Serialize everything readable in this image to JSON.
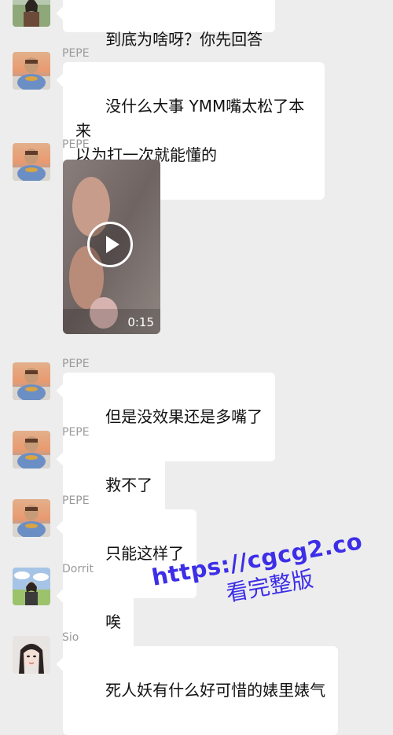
{
  "messages": [
    {
      "sender": "",
      "text": "到底为啥呀？你先回答",
      "avatar_icon": "landscape-girl-avatar-icon"
    },
    {
      "sender": "PEPE",
      "text": "没什么大事 YMM嘴太松了本来\n以为打一次就能懂的",
      "avatar_icon": "pepe-avatar-icon"
    },
    {
      "sender": "PEPE",
      "video": {
        "duration": "0:15"
      },
      "avatar_icon": "pepe-avatar-icon"
    },
    {
      "sender": "PEPE",
      "text": "但是没效果还是多嘴了",
      "avatar_icon": "pepe-avatar-icon"
    },
    {
      "sender": "PEPE",
      "text": "救不了",
      "avatar_icon": "pepe-avatar-icon"
    },
    {
      "sender": "PEPE",
      "text": "只能这样了",
      "avatar_icon": "pepe-avatar-icon"
    },
    {
      "sender": "Dorrit",
      "text": "唉",
      "avatar_icon": "dorrit-avatar-icon"
    },
    {
      "sender": "Sio",
      "text": "死人妖有什么好可惜的婊里婊气",
      "avatar_icon": "sio-avatar-icon"
    }
  ],
  "watermark": {
    "url": "https://cgcg2.co",
    "text": "看完整版"
  },
  "colors": {
    "background": "#ededed",
    "bubble": "#ffffff",
    "sender_name": "#9a9a9a",
    "watermark": "#3d2ee8"
  }
}
